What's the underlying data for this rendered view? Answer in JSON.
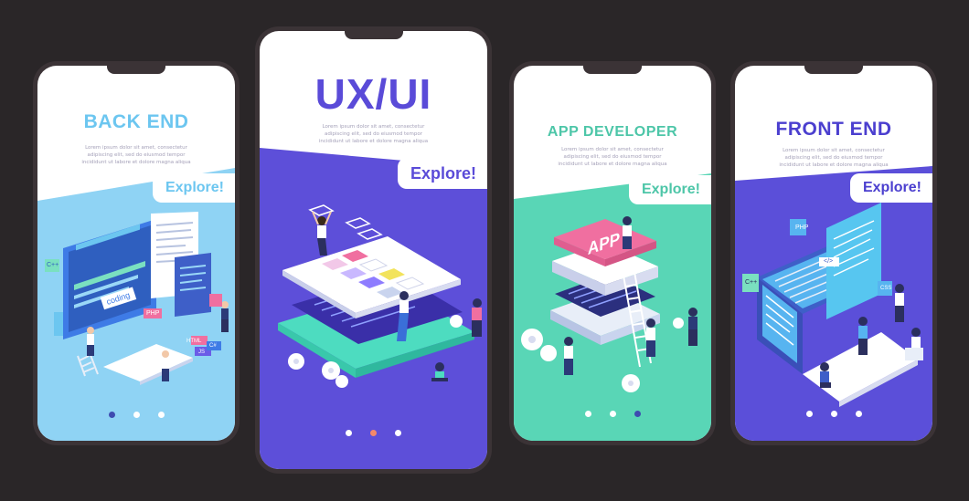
{
  "screens": [
    {
      "title": "BACK END",
      "lorem": [
        "Lorem ipsum dolor sit amet, consectetur",
        "adipiscing elit, sed do eiusmod tempor",
        "incididunt ut labore et dolore magna aliqua"
      ],
      "explore": "Explore!",
      "labels": {
        "coding": "coding",
        "php": "PHP",
        "cpp": "C++",
        "html": "HTML",
        "js": "JS",
        "cs": "C#"
      },
      "active_dot": 0,
      "colors": {
        "title": "#6cc6f0",
        "bg": "#8fd3f4",
        "accent": "#3e7be6"
      }
    },
    {
      "title": "UX/UI",
      "lorem": [
        "Lorem ipsum dolor sit amet, consectetur",
        "adipiscing elit, sed do eiusmod tempor",
        "incididunt ut labore et dolore magna aliqua"
      ],
      "explore": "Explore!",
      "labels": {},
      "active_dot": 1,
      "colors": {
        "title": "#5a4bd8",
        "bg": "#5d4fd9",
        "accent": "#4ddcc0"
      }
    },
    {
      "title": "APP DEVELOPER",
      "lorem": [
        "Lorem ipsum dolor sit amet, consectetur",
        "adipiscing elit, sed do eiusmod tempor",
        "incididunt ut labore et dolore magna aliqua"
      ],
      "explore": "Explore!",
      "labels": {
        "app": "APP"
      },
      "active_dot": 2,
      "colors": {
        "title": "#4dc6a8",
        "bg": "#59d6b6",
        "accent": "#f06fa0"
      }
    },
    {
      "title": "FRONT END",
      "lorem": [
        "Lorem ipsum dolor sit amet, consectetur",
        "adipiscing elit, sed do eiusmod tempor",
        "incididunt ut labore et dolore magna aliqua"
      ],
      "explore": "Explore!",
      "labels": {
        "php": "PHP",
        "cpp": "C++",
        "css": "CSS",
        "code": "</>"
      },
      "active_dot": 0,
      "colors": {
        "title": "#4b3fcf",
        "bg": "#5b4fd9",
        "accent": "#57b4f0"
      }
    }
  ]
}
